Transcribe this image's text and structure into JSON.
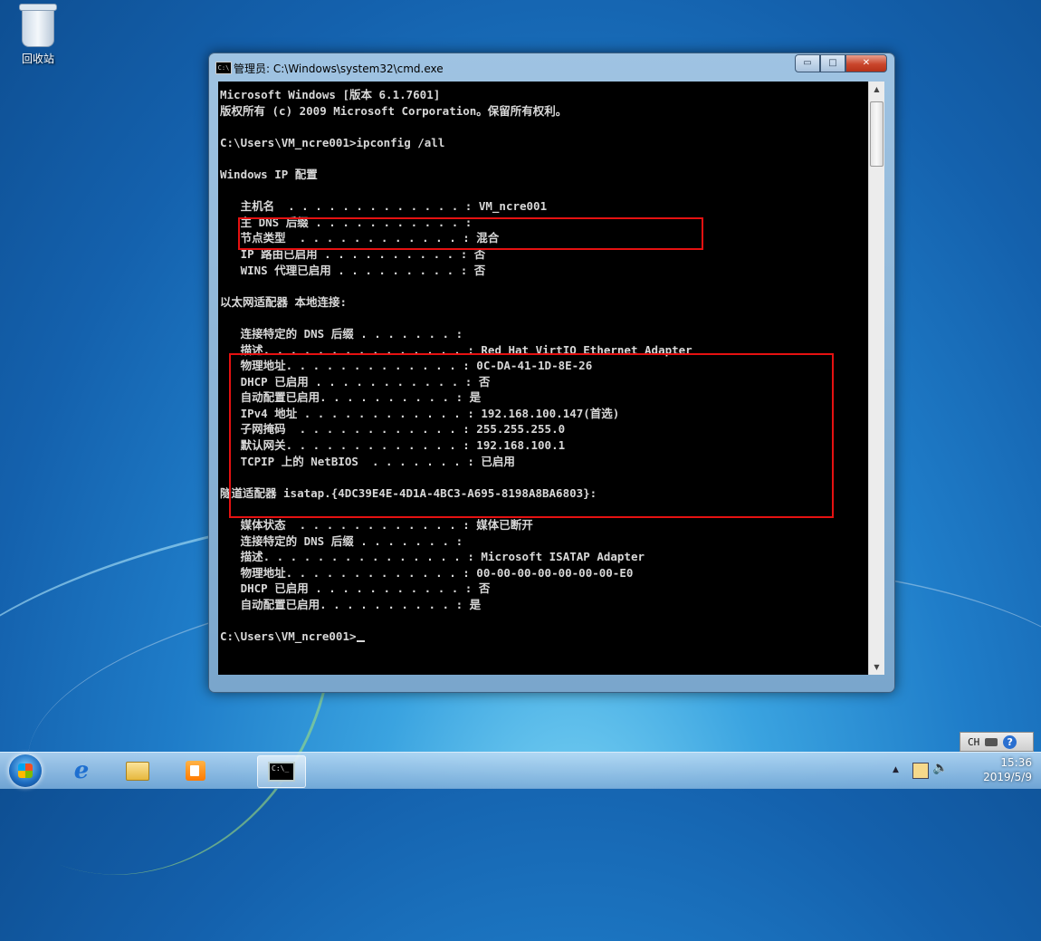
{
  "desktop": {
    "icons": [
      {
        "label": "回收站",
        "icon": "recycle-bin-icon"
      }
    ]
  },
  "window": {
    "title": "管理员: C:\\Windows\\system32\\cmd.exe",
    "controls": {
      "minimize": "▭",
      "maximize": "□",
      "close": "✕"
    },
    "console_lines": [
      "Microsoft Windows [版本 6.1.7601]",
      "版权所有 (c) 2009 Microsoft Corporation。保留所有权利。",
      "",
      "C:\\Users\\VM_ncre001>ipconfig /all",
      "",
      "Windows IP 配置",
      "",
      "   主机名  . . . . . . . . . . . . . : VM_ncre001",
      "   主 DNS 后缀 . . . . . . . . . . . :",
      "   节点类型  . . . . . . . . . . . . : 混合",
      "   IP 路由已启用 . . . . . . . . . . : 否",
      "   WINS 代理已启用 . . . . . . . . . : 否",
      "",
      "以太网适配器 本地连接:",
      "",
      "   连接特定的 DNS 后缀 . . . . . . . :",
      "   描述. . . . . . . . . . . . . . . : Red Hat VirtIO Ethernet Adapter",
      "   物理地址. . . . . . . . . . . . . : 0C-DA-41-1D-8E-26",
      "   DHCP 已启用 . . . . . . . . . . . : 否",
      "   自动配置已启用. . . . . . . . . . : 是",
      "   IPv4 地址 . . . . . . . . . . . . : 192.168.100.147(首选)",
      "   子网掩码  . . . . . . . . . . . . : 255.255.255.0",
      "   默认网关. . . . . . . . . . . . . : 192.168.100.1",
      "   TCPIP 上的 NetBIOS  . . . . . . . : 已启用",
      "",
      "隧道适配器 isatap.{4DC39E4E-4D1A-4BC3-A695-8198A8BA6803}:",
      "",
      "   媒体状态  . . . . . . . . . . . . : 媒体已断开",
      "   连接特定的 DNS 后缀 . . . . . . . :",
      "   描述. . . . . . . . . . . . . . . : Microsoft ISATAP Adapter",
      "   物理地址. . . . . . . . . . . . . : 00-00-00-00-00-00-00-E0",
      "   DHCP 已启用 . . . . . . . . . . . : 否",
      "   自动配置已启用. . . . . . . . . . : 是",
      "",
      "C:\\Users\\VM_ncre001>"
    ],
    "highlight_color": "#e51111"
  },
  "taskbar": {
    "buttons": [
      "start-orb",
      "internet-explorer-icon",
      "windows-explorer-icon",
      "media-player-icon",
      "cmd-icon"
    ],
    "tray": {
      "language": "CH",
      "time": "15:36",
      "date": "2019/5/9"
    }
  }
}
